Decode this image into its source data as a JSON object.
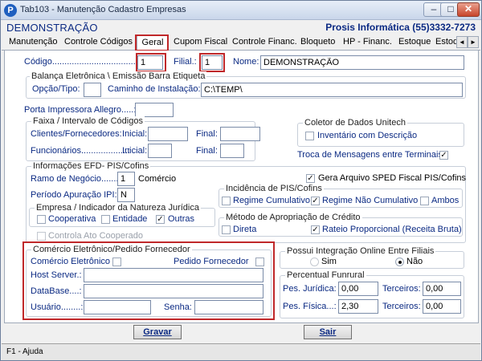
{
  "window": {
    "title": "Tab103 - Manutenção Cadastro Empresas",
    "app_icon": "P",
    "minimize_glyph": "–",
    "maximize_glyph": "□",
    "close_glyph": "✕"
  },
  "header": {
    "company": "DEMONSTRAÇÃO",
    "contact": "Prosis Informática (55)3332-7273"
  },
  "tabs": [
    {
      "label": "Manutenção"
    },
    {
      "label": "Controle Códigos"
    },
    {
      "label": "Geral"
    },
    {
      "label": "Cupom Fiscal"
    },
    {
      "label": "Controle Financ."
    },
    {
      "label": "Bloqueto"
    },
    {
      "label": "HP - Financ."
    },
    {
      "label": "Estoque"
    },
    {
      "label": "Estoq"
    }
  ],
  "tab_nav": {
    "prev": "◄",
    "next": "►"
  },
  "top": {
    "codigo_label": "Código...................................................",
    "codigo_value": "1",
    "filial_label": "Filial.:",
    "filial_value": "1",
    "nome_label": "Nome:",
    "nome_value": "DEMONSTRAÇÃO"
  },
  "balanca": {
    "title": "Balança Eletrônica \\ Emissão Barra Etiqueta",
    "opcao_label": "Opção/Tipo:",
    "opcao_value": "",
    "caminho_label": "Caminho de Instalação:",
    "caminho_value": "C:\\TEMP\\"
  },
  "porta": {
    "label": "Porta Impressora Allegro.....:",
    "value": ""
  },
  "faixa": {
    "title": "Faixa / Intervalo de Códigos",
    "clientes_label": "Clientes/Fornecedores:",
    "funcionarios_label": "Funcionários...................:",
    "inicial_label": "Inicial:",
    "final_label": "Final:"
  },
  "coletor": {
    "title": "Coletor de Dados Unitech",
    "inventario_label": "Inventário com Descrição",
    "inventario_checked": ""
  },
  "troca": {
    "label": "Troca de Mensagens entre Terminais",
    "checked": "✓"
  },
  "efd": {
    "title": "Informações EFD- PIS/Cofins",
    "ramo_label": "Ramo de Negócio.........:",
    "ramo_value": "1",
    "ramo_desc": "Comércio",
    "apuracao_label": "Período Apuração IPI:",
    "apuracao_value": "N",
    "sped_label": "Gera Arquivo SPED Fiscal PIS/Cofins",
    "sped_checked": "✓",
    "empresa_title": "Empresa / Indicador da Natureza Jurídica",
    "cooperativa_label": "Cooperativa",
    "cooperativa_checked": "",
    "entidade_label": "Entidade",
    "entidade_checked": "",
    "outras_label": "Outras",
    "outras_checked": "✓",
    "controla_label": "Controla Ato Cooperado",
    "controla_checked": ""
  },
  "incidencia": {
    "title": "Incidência de PIS/Cofins",
    "cumulativo_label": "Regime Cumulativo",
    "cumulativo_checked": "",
    "nao_cumulativo_label": "Regime Não Cumulativo",
    "nao_cumulativo_checked": "✓",
    "ambos_label": "Ambos",
    "ambos_checked": ""
  },
  "metodo": {
    "title": "Método de Apropriação de Crédito",
    "direta_label": "Direta",
    "direta_checked": "",
    "rateio_label": "Rateio Proporcional (Receita Bruta)",
    "rateio_checked": "✓"
  },
  "comercio": {
    "title": "Comércio Eletrônico/Pedido Fornecedor",
    "comercio_label": "Comércio Eletrônico",
    "comercio_checked": "",
    "pedido_label": "Pedido Fornecedor",
    "pedido_checked": "",
    "host_label": "Host Server.:",
    "host_value": "",
    "database_label": "DataBase....:",
    "database_value": "",
    "usuario_label": "Usuário........:",
    "usuario_value": "",
    "senha_label": "Senha:",
    "senha_value": ""
  },
  "integracao": {
    "title": "Possui Integração Online Entre Filiais",
    "sim_label": "Sim",
    "nao_label": "Não",
    "selected": "Não"
  },
  "funrural": {
    "title": "Percentual Funrural",
    "pj_label": "Pes. Jurídica:",
    "pj_value": "0,00",
    "pf_label": "Pes. Física...:",
    "pf_value": "2,30",
    "terceiros_label": "Terceiros:",
    "terceiros_pj_value": "0,00",
    "terceiros_pf_value": "0,00"
  },
  "buttons": {
    "gravar": "Gravar",
    "sair": "Sair"
  },
  "status": {
    "text": "F1 - Ajuda"
  },
  "colors": {
    "label_blue": "#0b2a83",
    "highlight_red": "#c0282a",
    "panel_bg": "#ffffff",
    "window_bg": "#f0f0f0"
  }
}
